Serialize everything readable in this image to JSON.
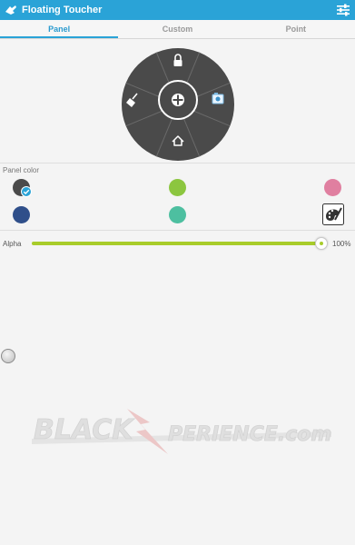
{
  "app": {
    "title": "Floating Toucher"
  },
  "tabs": [
    {
      "label": "Panel",
      "active": true
    },
    {
      "label": "Custom",
      "active": false
    },
    {
      "label": "Point",
      "active": false
    }
  ],
  "panel": {
    "icons": [
      "lock-icon",
      "screenshot-icon",
      "home-icon",
      "broom-icon",
      "center-menu-icon"
    ],
    "color": "#4a4a4a"
  },
  "panel_color": {
    "label": "Panel color",
    "swatches": [
      {
        "color": "#4a4a4a",
        "selected": true
      },
      {
        "color": "#8cc63f",
        "selected": false
      },
      {
        "color": "#e07fa0",
        "selected": false
      },
      {
        "color": "#2f4f8a",
        "selected": false
      },
      {
        "color": "#4dbfa0",
        "selected": false
      }
    ],
    "custom_icon": "palette-icon"
  },
  "alpha": {
    "label": "Alpha",
    "value": "100%",
    "level": 1.0,
    "color": "#a8cc2b"
  },
  "watermark": {
    "text": "BLACKXPERIENCE.com"
  },
  "theme": {
    "accent": "#2aa3d7"
  }
}
